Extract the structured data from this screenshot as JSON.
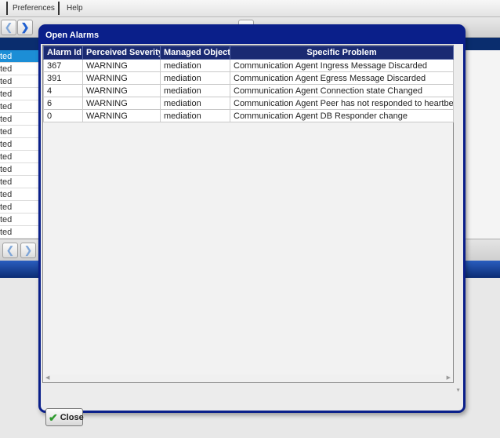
{
  "menu": {
    "preferences": "Preferences",
    "help": "Help"
  },
  "background_list": {
    "fragment": "ted",
    "rows": 15
  },
  "dialog": {
    "title": "Open Alarms",
    "columns": [
      "Alarm Id",
      "Perceived Severity",
      "Managed Object",
      "Specific Problem"
    ],
    "rows": [
      {
        "id": "367",
        "severity": "WARNING",
        "object": "mediation",
        "problem": "Communication Agent Ingress Message Discarded"
      },
      {
        "id": "391",
        "severity": "WARNING",
        "object": "mediation",
        "problem": "Communication Agent Egress Message Discarded"
      },
      {
        "id": "4",
        "severity": "WARNING",
        "object": "mediation",
        "problem": "Communication Agent Connection state Changed"
      },
      {
        "id": "6",
        "severity": "WARNING",
        "object": "mediation",
        "problem": "Communication Agent Peer has not responded to heartbeat"
      },
      {
        "id": "0",
        "severity": "WARNING",
        "object": "mediation",
        "problem": "Communication Agent DB Responder change"
      }
    ],
    "close_label": "Close"
  },
  "icons": {
    "back": "back-arrow-icon",
    "forward": "forward-arrow-icon",
    "close": "check-icon"
  },
  "colors": {
    "dialog_frame": "#0a1f8a",
    "header": "#1a2a72",
    "selection": "#1c8ed6"
  }
}
